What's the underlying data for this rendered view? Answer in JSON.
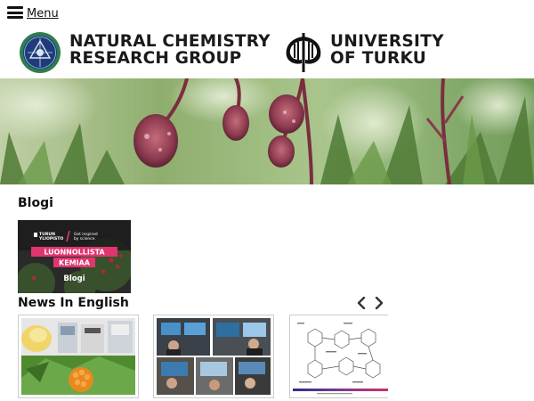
{
  "menu": {
    "label": "Menu"
  },
  "header": {
    "group_name_line1": "NATURAL CHEMISTRY",
    "group_name_line2": "RESEARCH GROUP",
    "university_line1": "UNIVERSITY",
    "university_line2": "OF TURKU"
  },
  "blog_section": {
    "title": "Blogi",
    "card": {
      "brand_line1": "TURUN",
      "brand_line2": "YLIOPISTO",
      "tagline_line1": "Get inspired",
      "tagline_line2": "by science.",
      "banner_line1": "LUONNOLLISTA",
      "banner_line2": "KEMIAA",
      "caption": "Blogi"
    }
  },
  "news_section": {
    "title": "News In English",
    "prev_icon": "chevron-left-icon",
    "next_icon": "chevron-right-icon"
  },
  "colors": {
    "accent_pink": "#e0356e",
    "dark_card": "#2a2a2a",
    "ncrg_green": "#2e7d4f",
    "ncrg_blue": "#1f3b7a"
  }
}
